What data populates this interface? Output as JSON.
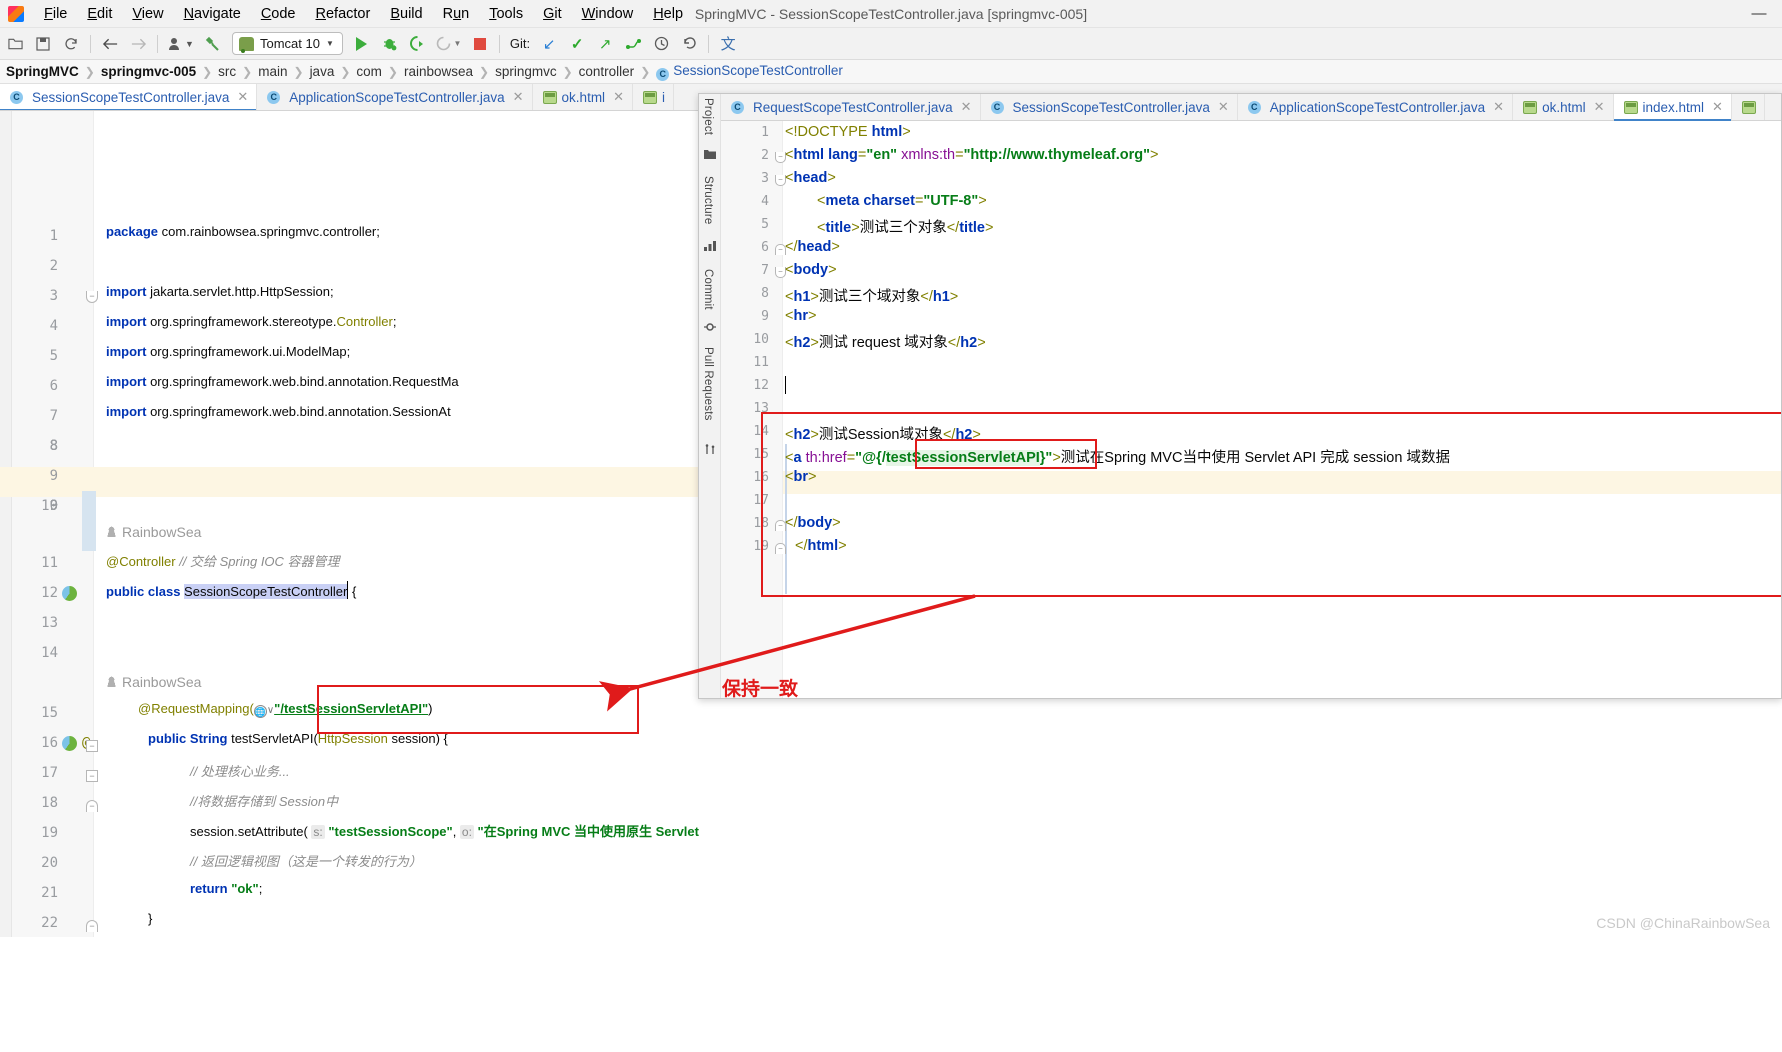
{
  "window": {
    "title": "SpringMVC - SessionScopeTestController.java [springmvc-005]",
    "minimize": "—",
    "maximize": "□",
    "close": "✕"
  },
  "menu": [
    "File",
    "Edit",
    "View",
    "Navigate",
    "Code",
    "Refactor",
    "Build",
    "Run",
    "Tools",
    "Git",
    "Window",
    "Help"
  ],
  "toolbar": {
    "run_config": "Tomcat 10",
    "git_label": "Git:",
    "icons": [
      "open-icon",
      "save-icon",
      "sync-icon",
      "back-arrow-icon",
      "forward-arrow-icon",
      "profile-icon",
      "build-hammer-icon",
      "run-icon",
      "debug-icon",
      "run-coverage-icon",
      "profiler-icon",
      "stop-icon",
      "git-update-icon",
      "git-commit-icon",
      "git-push-icon",
      "git-rollback-icon",
      "history-icon",
      "undo-icon",
      "translate-icon"
    ]
  },
  "breadcrumb": [
    "SpringMVC",
    "springmvc-005",
    "src",
    "main",
    "java",
    "com",
    "rainbowsea",
    "springmvc",
    "controller",
    "SessionScopeTestController"
  ],
  "left_tabs": [
    {
      "label": "SessionScopeTestController.java",
      "icon": "java-class-icon",
      "active": true
    },
    {
      "label": "ApplicationScopeTestController.java",
      "icon": "java-class-icon",
      "active": false
    },
    {
      "label": "ok.html",
      "icon": "html-file-icon",
      "active": false
    },
    {
      "label": "i",
      "icon": "html-file-icon",
      "active": false
    }
  ],
  "right_tabs": [
    {
      "label": "RequestScopeTestController.java",
      "icon": "java-class-icon",
      "active": false
    },
    {
      "label": "SessionScopeTestController.java",
      "icon": "java-class-icon",
      "active": false
    },
    {
      "label": "ApplicationScopeTestController.java",
      "icon": "java-class-icon",
      "active": false
    },
    {
      "label": "ok.html",
      "icon": "html-file-icon",
      "active": false
    },
    {
      "label": "index.html",
      "icon": "html-file-icon",
      "active": true
    }
  ],
  "tool_rail": [
    "Project",
    "Structure",
    "Commit",
    "Pull Requests"
  ],
  "java_editor": {
    "author_tag": "RainbowSea",
    "lines": [
      {
        "n": "1",
        "code": "package com.rainbowsea.springmvc.controller;"
      },
      {
        "n": "2",
        "code": ""
      },
      {
        "n": "3",
        "code": "import jakarta.servlet.http.HttpSession;"
      },
      {
        "n": "4",
        "code": "import org.springframework.stereotype.Controller;"
      },
      {
        "n": "5",
        "code": "import org.springframework.ui.ModelMap;"
      },
      {
        "n": "6",
        "code": "import org.springframework.web.bind.annotation.RequestMa"
      },
      {
        "n": "7",
        "code": "import org.springframework.web.bind.annotation.SessionAt"
      },
      {
        "n": "8",
        "code": ""
      },
      {
        "n": "9",
        "code": ""
      },
      {
        "n": "10",
        "code": ""
      },
      {
        "n": "11",
        "code": "@Controller // 交给 Spring IOC 容器管理"
      },
      {
        "n": "12",
        "code": "public class SessionScopeTestController {"
      },
      {
        "n": "13",
        "code": ""
      },
      {
        "n": "14",
        "code": ""
      },
      {
        "n": "15",
        "code": "@RequestMapping(\"/testSessionServletAPI\")"
      },
      {
        "n": "16",
        "code": "public String testServletAPI(HttpSession session) {"
      },
      {
        "n": "17",
        "code": "// 处理核心业务..."
      },
      {
        "n": "18",
        "code": "//将数据存储到 Session中"
      },
      {
        "n": "19",
        "code": "session.setAttribute( s: \"testSessionScope\", o: \"在Spring MVC 当中使用原生 Servlet API 完成 session 域数据共享\");"
      },
      {
        "n": "20",
        "code": "// 返回逻辑视图（这是一个转发的行为）"
      },
      {
        "n": "21",
        "code": "return \"ok\";"
      },
      {
        "n": "22",
        "code": "}"
      }
    ],
    "mapping_path": "/testSessionServletAPI",
    "attribute_name": "testSessionScope",
    "attribute_value": "在Spring MVC 当中使用原生 Servlet API 完成 session 域数据共享",
    "return_value": "ok",
    "param_hint_s": "s:",
    "param_hint_o": "o:"
  },
  "html_editor": {
    "lines": [
      {
        "n": "1",
        "code": "<!DOCTYPE html>"
      },
      {
        "n": "2",
        "code": "<html lang=\"en\" xmlns:th=\"http://www.thymeleaf.org\">"
      },
      {
        "n": "3",
        "code": "<head>"
      },
      {
        "n": "4",
        "code": "    <meta charset=\"UTF-8\">"
      },
      {
        "n": "5",
        "code": "    <title>测试三个对象</title>"
      },
      {
        "n": "6",
        "code": "</head>"
      },
      {
        "n": "7",
        "code": "<body>"
      },
      {
        "n": "8",
        "code": "<h1>测试三个域对象</h1>"
      },
      {
        "n": "9",
        "code": "<hr>"
      },
      {
        "n": "10",
        "code": "<h2>测试 request 域对象</h2>"
      },
      {
        "n": "11",
        "code": ""
      },
      {
        "n": "12",
        "code": ""
      },
      {
        "n": "13",
        "code": ""
      },
      {
        "n": "14",
        "code": "<h2>测试Session域对象</h2>"
      },
      {
        "n": "15",
        "code": "<a th:href=\"@{/testSessionServletAPI}\">测试在Spring MVC当中使用 Servlet API 完成 session 域数据"
      },
      {
        "n": "16",
        "code": "<br>"
      },
      {
        "n": "17",
        "code": ""
      },
      {
        "n": "18",
        "code": "</body>"
      },
      {
        "n": "19",
        "code": "</html>"
      }
    ],
    "highlighted_url": "testSessionServletAPI"
  },
  "annotations": {
    "note_text": "保持一致",
    "red_color": "#e01b1b"
  },
  "watermark": "CSDN @ChinaRainbowSea"
}
